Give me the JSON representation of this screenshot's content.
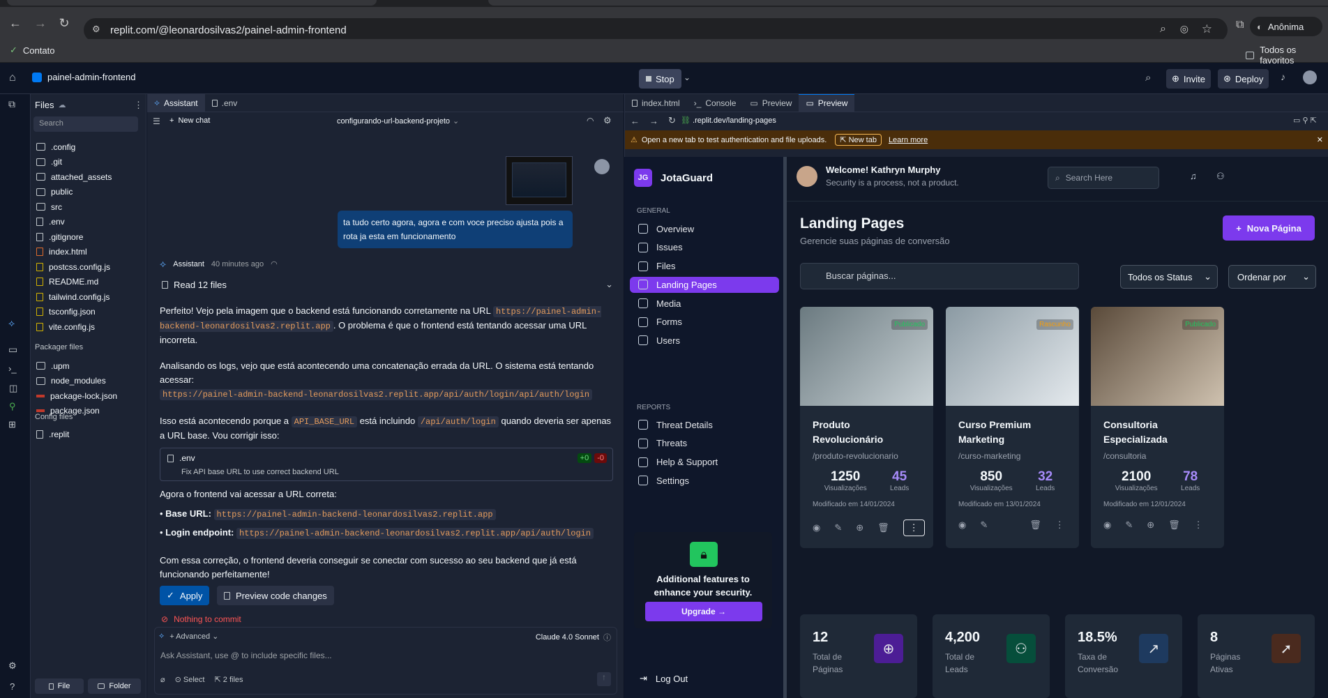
{
  "browser": {
    "url": "replit.com/@leonardosilvas2/painel-admin-frontend",
    "profile": "Anônima",
    "bookmark": "Contato",
    "all_bookmarks": "Todos os favoritos"
  },
  "replit": {
    "project_name": "painel-admin-frontend",
    "stop_label": "Stop",
    "invite_label": "Invite",
    "deploy_label": "Deploy"
  },
  "files": {
    "title": "Files",
    "search_placeholder": "Search",
    "items": [
      ".config",
      ".git",
      "attached_assets",
      "public",
      "src",
      ".env",
      ".gitignore",
      "index.html",
      "postcss.config.js",
      "README.md",
      "tailwind.config.js",
      "tsconfig.json",
      "vite.config.js"
    ],
    "packager_title": "Packager files",
    "packager_items": [
      ".upm",
      "node_modules",
      "package-lock.json",
      "package.json"
    ],
    "config_title": "Config files",
    "config_items": [
      ".replit"
    ],
    "new_file": "File",
    "new_folder": "Folder"
  },
  "assistant": {
    "tab_assistant": "Assistant",
    "tab_env": ".env",
    "new_chat": "New chat",
    "chat_title": "configurando-url-backend-projeto",
    "user_message": "ta tudo certo agora, agora e com voce preciso ajusta pois a rota ja esta em funcionamento",
    "sender": "Assistant",
    "time": "40 minutes ago",
    "read_files": "Read 12 files",
    "p1a": "Perfeito! Vejo pela imagem que o backend está funcionando corretamente na URL",
    "p1code": "https://painel-admin-backend-leonardosilvas2.replit.app",
    "p1b": ". O problema é que o frontend está tentando acessar uma URL incorreta.",
    "p2a": "Analisando os logs, vejo que está acontecendo uma concatenação errada da URL. O sistema está tentando acessar:",
    "p2code": "https://painel-admin-backend-leonardosilvas2.replit.app/api/auth/login/api/auth/login",
    "p3a": "Isso está acontecendo porque a",
    "p3code1": "API_BASE_URL",
    "p3b": "está incluindo",
    "p3code2": "/api/auth/login",
    "p3c": "quando deveria ser apenas a URL base. Vou corrigir isso:",
    "change_file": ".env",
    "change_desc": "Fix API base URL to use correct backend URL",
    "change_add": "+0",
    "change_del": "-0",
    "p4": "Agora o frontend vai acessar a URL correta:",
    "bullet1_label": "Base URL:",
    "bullet1_code": "https://painel-admin-backend-leonardosilvas2.replit.app",
    "bullet2_label": "Login endpoint:",
    "bullet2_code": "https://painel-admin-backend-leonardosilvas2.replit.app/api/auth/login",
    "p5": "Com essa correção, o frontend deveria conseguir se conectar com sucesso ao seu backend que já está funcionando perfeitamente!",
    "apply": "Apply",
    "preview_changes": "Preview code changes",
    "nothing_commit": "Nothing to commit",
    "advanced": "Advanced",
    "model": "Claude 4.0 Sonnet",
    "input_placeholder": "Ask Assistant, use @ to include specific files...",
    "select": "Select",
    "files_count": "2 files"
  },
  "preview": {
    "tabs": [
      "index.html",
      "Console",
      "Preview",
      "Preview"
    ],
    "addr": ".replit.dev/landing-pages",
    "warning": "Open a new tab to test authentication and file uploads.",
    "new_tab": "New tab",
    "learn_more": "Learn more"
  },
  "app": {
    "logo_initials": "JG",
    "brand": "JotaGuard",
    "welcome": "Welcome! Kathryn Murphy",
    "tagline": "Security is a process, not a product.",
    "search_placeholder": "Search Here",
    "general_label": "GENERAL",
    "nav_general": [
      "Overview",
      "Issues",
      "Files",
      "Landing Pages",
      "Media",
      "Forms",
      "Users"
    ],
    "reports_label": "REPORTS",
    "nav_reports": [
      "Threat Details",
      "Threats",
      "Help & Support",
      "Settings"
    ],
    "promo_text": "Additional features to enhance your security.",
    "upgrade": "Upgrade →",
    "logout": "Log Out",
    "page_title": "Landing Pages",
    "page_subtitle": "Gerencie suas páginas de conversão",
    "new_page": "Nova Página",
    "search_pages": "Buscar páginas...",
    "status_filter": "Todos os Status",
    "sort": "Ordenar por",
    "cards": [
      {
        "title": "Produto Revolucionário",
        "slug": "/produto-revolucionario",
        "views": "1250",
        "leads": "45",
        "views_label": "Visualizações",
        "leads_label": "Leads",
        "modified": "Modificado em 14/01/2024",
        "status": "Publicado"
      },
      {
        "title": "Curso Premium Marketing",
        "slug": "/curso-marketing",
        "views": "850",
        "leads": "32",
        "views_label": "Visualizações",
        "leads_label": "Leads",
        "modified": "Modificado em 13/01/2024",
        "status": "Rascunho"
      },
      {
        "title": "Consultoria Especializada",
        "slug": "/consultoria",
        "views": "2100",
        "leads": "78",
        "views_label": "Visualizações",
        "leads_label": "Leads",
        "modified": "Modificado em 12/01/2024",
        "status": "Publicado"
      }
    ],
    "stats": [
      {
        "value": "12",
        "label": "Total de Páginas",
        "icon": "globe-icon",
        "color": "#4c1d95"
      },
      {
        "value": "4,200",
        "label": "Total de Leads",
        "icon": "users-icon",
        "color": "#064e3b"
      },
      {
        "value": "18.5%",
        "label": "Taxa de Conversão",
        "icon": "chart-icon",
        "color": "#1e3a5f"
      },
      {
        "value": "8",
        "label": "Páginas Ativas",
        "icon": "rocket-icon",
        "color": "#4a2a1e"
      }
    ]
  },
  "colors": {
    "accent": "#7c3aed",
    "replit_bg": "#0e1525",
    "panel": "#1c2333",
    "code": "#e59c5d",
    "apply": "#0053a6"
  }
}
